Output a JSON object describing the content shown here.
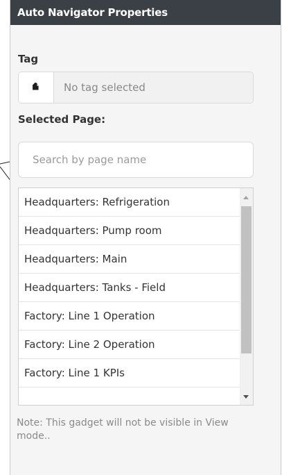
{
  "header": {
    "title": "Auto Navigator Properties"
  },
  "tag": {
    "label": "Tag",
    "icon": "tag-icon",
    "value": "No tag selected"
  },
  "selected_page": {
    "label": "Selected Page:",
    "search_placeholder": "Search by page name",
    "search_value": "",
    "pages": [
      "Headquarters: Refrigeration",
      "Headquarters: Pump room",
      "Headquarters: Main",
      "Headquarters: Tanks - Field",
      "Factory: Line 1 Operation",
      "Factory: Line 2 Operation",
      "Factory: Line 1 KPIs"
    ]
  },
  "note": "Note: This gadget will not be visible in View mode..",
  "colors": {
    "header_bg": "#3b3f46",
    "panel_bg": "#f5f5f5",
    "text": "#333333",
    "muted": "#8a8a8a"
  }
}
